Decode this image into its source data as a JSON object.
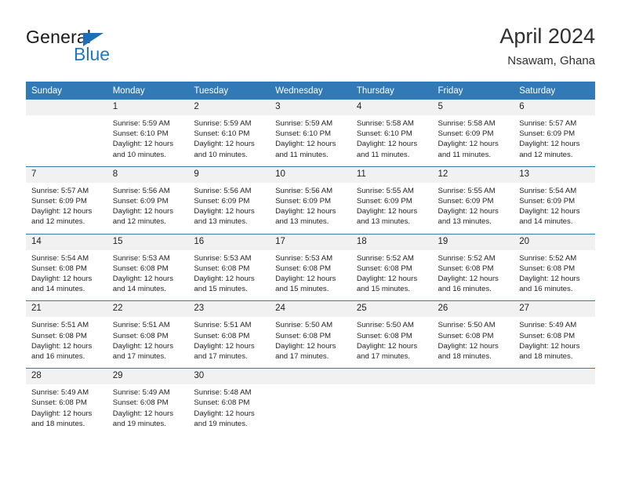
{
  "brand": {
    "name_top": "General",
    "name_bottom": "Blue",
    "color_dark": "#1a1a1a",
    "color_blue": "#1f78c1"
  },
  "header": {
    "title": "April 2024",
    "subtitle": "Nsawam, Ghana"
  },
  "calendar": {
    "header_bg": "#3279b8",
    "daynum_bg": "#f1f1f1",
    "weekdays": [
      "Sunday",
      "Monday",
      "Tuesday",
      "Wednesday",
      "Thursday",
      "Friday",
      "Saturday"
    ],
    "weeks": [
      [
        {
          "day": "",
          "blank": true,
          "sunrise": "",
          "sunset": "",
          "daylight_line1": "",
          "daylight_line2": ""
        },
        {
          "day": "1",
          "sunrise": "Sunrise: 5:59 AM",
          "sunset": "Sunset: 6:10 PM",
          "daylight_line1": "Daylight: 12 hours",
          "daylight_line2": "and 10 minutes."
        },
        {
          "day": "2",
          "sunrise": "Sunrise: 5:59 AM",
          "sunset": "Sunset: 6:10 PM",
          "daylight_line1": "Daylight: 12 hours",
          "daylight_line2": "and 10 minutes."
        },
        {
          "day": "3",
          "sunrise": "Sunrise: 5:59 AM",
          "sunset": "Sunset: 6:10 PM",
          "daylight_line1": "Daylight: 12 hours",
          "daylight_line2": "and 11 minutes."
        },
        {
          "day": "4",
          "sunrise": "Sunrise: 5:58 AM",
          "sunset": "Sunset: 6:10 PM",
          "daylight_line1": "Daylight: 12 hours",
          "daylight_line2": "and 11 minutes."
        },
        {
          "day": "5",
          "sunrise": "Sunrise: 5:58 AM",
          "sunset": "Sunset: 6:09 PM",
          "daylight_line1": "Daylight: 12 hours",
          "daylight_line2": "and 11 minutes."
        },
        {
          "day": "6",
          "sunrise": "Sunrise: 5:57 AM",
          "sunset": "Sunset: 6:09 PM",
          "daylight_line1": "Daylight: 12 hours",
          "daylight_line2": "and 12 minutes."
        }
      ],
      [
        {
          "day": "7",
          "sunrise": "Sunrise: 5:57 AM",
          "sunset": "Sunset: 6:09 PM",
          "daylight_line1": "Daylight: 12 hours",
          "daylight_line2": "and 12 minutes."
        },
        {
          "day": "8",
          "sunrise": "Sunrise: 5:56 AM",
          "sunset": "Sunset: 6:09 PM",
          "daylight_line1": "Daylight: 12 hours",
          "daylight_line2": "and 12 minutes."
        },
        {
          "day": "9",
          "sunrise": "Sunrise: 5:56 AM",
          "sunset": "Sunset: 6:09 PM",
          "daylight_line1": "Daylight: 12 hours",
          "daylight_line2": "and 13 minutes."
        },
        {
          "day": "10",
          "sunrise": "Sunrise: 5:56 AM",
          "sunset": "Sunset: 6:09 PM",
          "daylight_line1": "Daylight: 12 hours",
          "daylight_line2": "and 13 minutes."
        },
        {
          "day": "11",
          "sunrise": "Sunrise: 5:55 AM",
          "sunset": "Sunset: 6:09 PM",
          "daylight_line1": "Daylight: 12 hours",
          "daylight_line2": "and 13 minutes."
        },
        {
          "day": "12",
          "sunrise": "Sunrise: 5:55 AM",
          "sunset": "Sunset: 6:09 PM",
          "daylight_line1": "Daylight: 12 hours",
          "daylight_line2": "and 13 minutes."
        },
        {
          "day": "13",
          "sunrise": "Sunrise: 5:54 AM",
          "sunset": "Sunset: 6:09 PM",
          "daylight_line1": "Daylight: 12 hours",
          "daylight_line2": "and 14 minutes."
        }
      ],
      [
        {
          "day": "14",
          "sunrise": "Sunrise: 5:54 AM",
          "sunset": "Sunset: 6:08 PM",
          "daylight_line1": "Daylight: 12 hours",
          "daylight_line2": "and 14 minutes."
        },
        {
          "day": "15",
          "sunrise": "Sunrise: 5:53 AM",
          "sunset": "Sunset: 6:08 PM",
          "daylight_line1": "Daylight: 12 hours",
          "daylight_line2": "and 14 minutes."
        },
        {
          "day": "16",
          "sunrise": "Sunrise: 5:53 AM",
          "sunset": "Sunset: 6:08 PM",
          "daylight_line1": "Daylight: 12 hours",
          "daylight_line2": "and 15 minutes."
        },
        {
          "day": "17",
          "sunrise": "Sunrise: 5:53 AM",
          "sunset": "Sunset: 6:08 PM",
          "daylight_line1": "Daylight: 12 hours",
          "daylight_line2": "and 15 minutes."
        },
        {
          "day": "18",
          "sunrise": "Sunrise: 5:52 AM",
          "sunset": "Sunset: 6:08 PM",
          "daylight_line1": "Daylight: 12 hours",
          "daylight_line2": "and 15 minutes."
        },
        {
          "day": "19",
          "sunrise": "Sunrise: 5:52 AM",
          "sunset": "Sunset: 6:08 PM",
          "daylight_line1": "Daylight: 12 hours",
          "daylight_line2": "and 16 minutes."
        },
        {
          "day": "20",
          "sunrise": "Sunrise: 5:52 AM",
          "sunset": "Sunset: 6:08 PM",
          "daylight_line1": "Daylight: 12 hours",
          "daylight_line2": "and 16 minutes."
        }
      ],
      [
        {
          "day": "21",
          "sunrise": "Sunrise: 5:51 AM",
          "sunset": "Sunset: 6:08 PM",
          "daylight_line1": "Daylight: 12 hours",
          "daylight_line2": "and 16 minutes."
        },
        {
          "day": "22",
          "sunrise": "Sunrise: 5:51 AM",
          "sunset": "Sunset: 6:08 PM",
          "daylight_line1": "Daylight: 12 hours",
          "daylight_line2": "and 17 minutes."
        },
        {
          "day": "23",
          "sunrise": "Sunrise: 5:51 AM",
          "sunset": "Sunset: 6:08 PM",
          "daylight_line1": "Daylight: 12 hours",
          "daylight_line2": "and 17 minutes."
        },
        {
          "day": "24",
          "sunrise": "Sunrise: 5:50 AM",
          "sunset": "Sunset: 6:08 PM",
          "daylight_line1": "Daylight: 12 hours",
          "daylight_line2": "and 17 minutes."
        },
        {
          "day": "25",
          "sunrise": "Sunrise: 5:50 AM",
          "sunset": "Sunset: 6:08 PM",
          "daylight_line1": "Daylight: 12 hours",
          "daylight_line2": "and 17 minutes."
        },
        {
          "day": "26",
          "sunrise": "Sunrise: 5:50 AM",
          "sunset": "Sunset: 6:08 PM",
          "daylight_line1": "Daylight: 12 hours",
          "daylight_line2": "and 18 minutes."
        },
        {
          "day": "27",
          "sunrise": "Sunrise: 5:49 AM",
          "sunset": "Sunset: 6:08 PM",
          "daylight_line1": "Daylight: 12 hours",
          "daylight_line2": "and 18 minutes."
        }
      ],
      [
        {
          "day": "28",
          "sunrise": "Sunrise: 5:49 AM",
          "sunset": "Sunset: 6:08 PM",
          "daylight_line1": "Daylight: 12 hours",
          "daylight_line2": "and 18 minutes."
        },
        {
          "day": "29",
          "sunrise": "Sunrise: 5:49 AM",
          "sunset": "Sunset: 6:08 PM",
          "daylight_line1": "Daylight: 12 hours",
          "daylight_line2": "and 19 minutes."
        },
        {
          "day": "30",
          "sunrise": "Sunrise: 5:48 AM",
          "sunset": "Sunset: 6:08 PM",
          "daylight_line1": "Daylight: 12 hours",
          "daylight_line2": "and 19 minutes."
        },
        {
          "day": "",
          "blank": true,
          "sunrise": "",
          "sunset": "",
          "daylight_line1": "",
          "daylight_line2": ""
        },
        {
          "day": "",
          "blank": true,
          "sunrise": "",
          "sunset": "",
          "daylight_line1": "",
          "daylight_line2": ""
        },
        {
          "day": "",
          "blank": true,
          "sunrise": "",
          "sunset": "",
          "daylight_line1": "",
          "daylight_line2": ""
        },
        {
          "day": "",
          "blank": true,
          "sunrise": "",
          "sunset": "",
          "daylight_line1": "",
          "daylight_line2": ""
        }
      ]
    ]
  }
}
